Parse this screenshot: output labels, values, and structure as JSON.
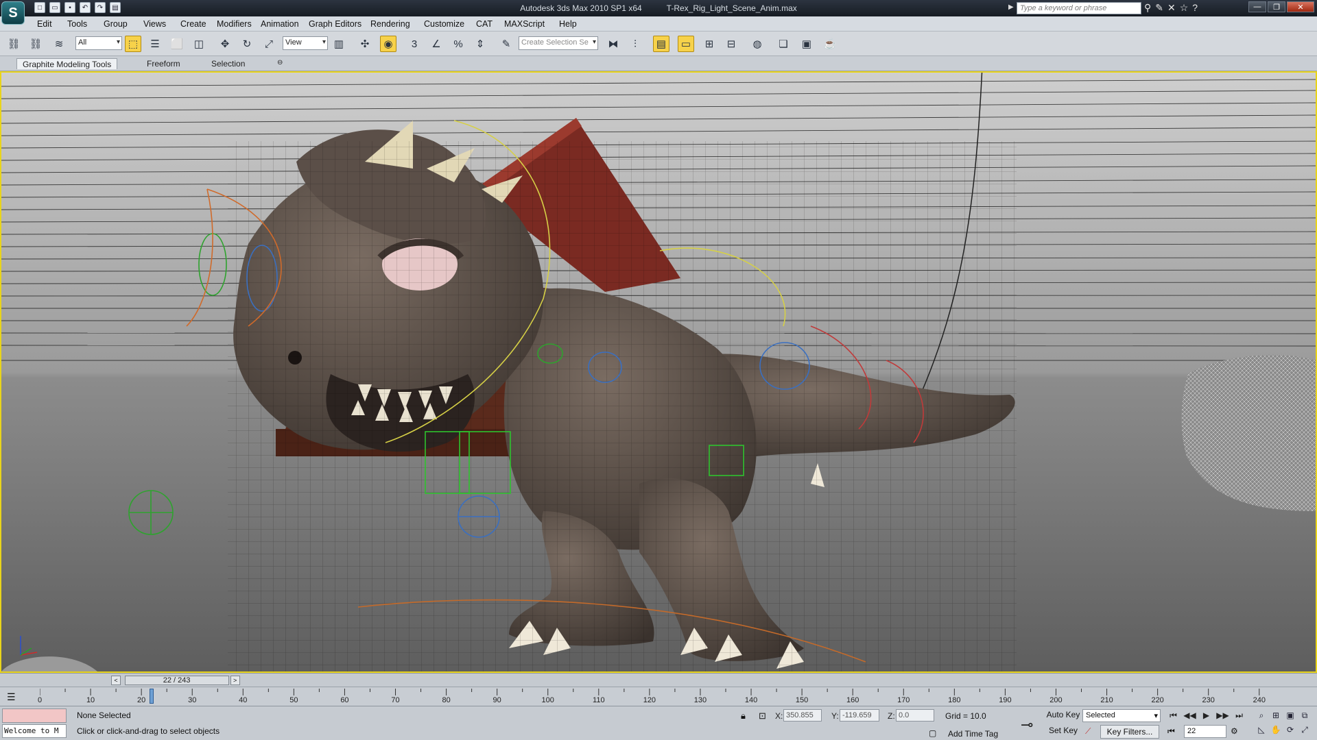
{
  "app": {
    "title": "Autodesk 3ds Max  2010 SP1 x64",
    "file": "T-Rex_Rig_Light_Scene_Anim.max",
    "logo": "S"
  },
  "quick_access": [
    "new-icon",
    "open-icon",
    "save-icon",
    "undo-icon",
    "redo-icon",
    "project-icon"
  ],
  "search": {
    "placeholder": "Type a keyword or phrase"
  },
  "menu": [
    "Edit",
    "Tools",
    "Group",
    "Views",
    "Create",
    "Modifiers",
    "Animation",
    "Graph Editors",
    "Rendering",
    "Customize",
    "CAT",
    "MAXScript",
    "Help"
  ],
  "toolbar": {
    "filter_value": "All",
    "ref_coord_value": "View",
    "snap_label": "3",
    "selection_set_placeholder": "Create Selection Se"
  },
  "ribbon": {
    "tabs": [
      "Graphite Modeling Tools",
      "Freeform",
      "Selection"
    ],
    "selected": 0
  },
  "frame_slider": {
    "label": "22 / 243",
    "prev": "<",
    "next": ">"
  },
  "timeline": {
    "ticks": [
      "0",
      "10",
      "20",
      "30",
      "40",
      "50",
      "60",
      "70",
      "80",
      "90",
      "100",
      "110",
      "120",
      "130",
      "140",
      "150",
      "160",
      "170",
      "180",
      "190",
      "200",
      "210",
      "220",
      "230",
      "240"
    ],
    "current_frame": 22,
    "total_frames": 243
  },
  "status": {
    "listener": "Welcome to M",
    "selection": "None Selected",
    "prompt": "Click or click-and-drag to select objects",
    "x_label": "X:",
    "x_value": "350.855",
    "y_label": "Y:",
    "y_value": "-119.659",
    "z_label": "Z:",
    "z_value": "0.0",
    "grid": "Grid = 10.0",
    "add_time_tag": "Add Time Tag",
    "auto_key": "Auto Key",
    "set_key": "Set Key",
    "key_mode": "Selected",
    "key_filters": "Key Filters...",
    "frame_field": "22"
  },
  "colors": {
    "viewport_border": "#e9d41a",
    "active_tool": "#f7d24a",
    "dino": "#4e443e"
  }
}
